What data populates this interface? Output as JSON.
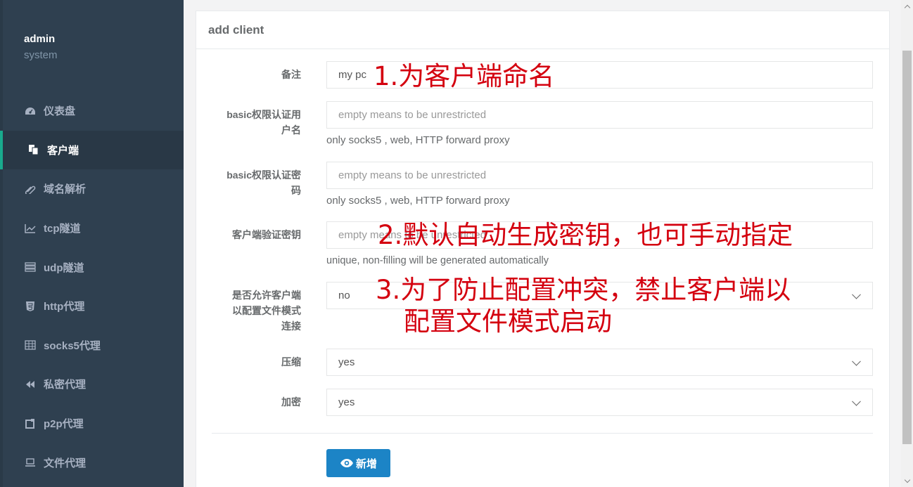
{
  "sidebar": {
    "profile": {
      "name": "admin",
      "role": "system"
    },
    "items": [
      {
        "label": "仪表盘",
        "icon": "dashboard-icon"
      },
      {
        "label": "客户端",
        "icon": "clients-icon",
        "active": true
      },
      {
        "label": "域名解析",
        "icon": "paperclip-icon"
      },
      {
        "label": "tcp隧道",
        "icon": "line-chart-icon"
      },
      {
        "label": "udp隧道",
        "icon": "server-icon"
      },
      {
        "label": "http代理",
        "icon": "html5-icon"
      },
      {
        "label": "socks5代理",
        "icon": "table-icon"
      },
      {
        "label": "私密代理",
        "icon": "backward-icon"
      },
      {
        "label": "p2p代理",
        "icon": "square-icon"
      },
      {
        "label": "文件代理",
        "icon": "laptop-icon"
      }
    ]
  },
  "panel": {
    "title": "add client",
    "fields": {
      "remark": {
        "label": "备注",
        "value": "my pc"
      },
      "basic_user": {
        "label_line1": "basic权限认证用",
        "label_line2": "户名",
        "placeholder": "empty means to be unrestricted",
        "help": "only socks5 , web, HTTP forward proxy"
      },
      "basic_pass": {
        "label_line1": "basic权限认证密",
        "label_line2": "码",
        "placeholder": "empty means to be unrestricted",
        "help": "only socks5 , web, HTTP forward proxy"
      },
      "verify_key": {
        "label": "客户端验证密钥",
        "placeholder": "empty means to be unrestricted",
        "help": "unique, non-filling will be generated automatically"
      },
      "config_conn": {
        "label_line1": "是否允许客户端",
        "label_line2": "以配置文件模式",
        "label_line3": "连接",
        "value": "no"
      },
      "compress": {
        "label": "压缩",
        "value": "yes"
      },
      "crypt": {
        "label": "加密",
        "value": "yes"
      }
    },
    "submit_label": "新增"
  },
  "annotations": {
    "a1": "1.为客户端命名",
    "a2": "2.默认自动生成密钥，也可手动指定",
    "a3_line1": "3.为了防止配置冲突，禁止客户端以",
    "a3_line2": "配置文件模式启动"
  },
  "colors": {
    "sidebar": "#2f4050",
    "active_bar": "#19aa8d",
    "button": "#1c84c6",
    "annotation": "#d4000f"
  }
}
